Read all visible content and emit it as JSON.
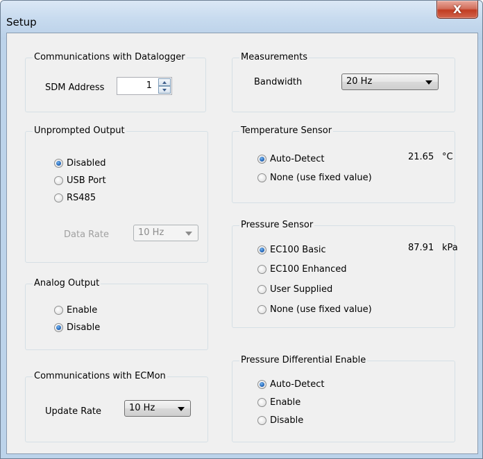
{
  "window": {
    "title": "Setup",
    "close_glyph": "X"
  },
  "comm_datalogger": {
    "title": "Communications with Datalogger",
    "sdm_label": "SDM Address",
    "sdm_value": "1"
  },
  "measurements": {
    "title": "Measurements",
    "bandwidth_label": "Bandwidth",
    "bandwidth_value": "20 Hz"
  },
  "unprompted_output": {
    "title": "Unprompted Output",
    "options": [
      "Disabled",
      "USB Port",
      "RS485"
    ],
    "selected": "Disabled",
    "data_rate_label": "Data Rate",
    "data_rate_value": "10 Hz"
  },
  "temperature_sensor": {
    "title": "Temperature Sensor",
    "options": [
      "Auto-Detect",
      "None (use fixed value)"
    ],
    "selected": "Auto-Detect",
    "reading_value": "21.65",
    "reading_unit": "°C"
  },
  "pressure_sensor": {
    "title": "Pressure Sensor",
    "options": [
      "EC100 Basic",
      "EC100 Enhanced",
      "User Supplied",
      "None (use fixed value)"
    ],
    "selected": "EC100 Basic",
    "reading_value": "87.91",
    "reading_unit": "kPa"
  },
  "analog_output": {
    "title": "Analog Output",
    "options": [
      "Enable",
      "Disable"
    ],
    "selected": "Disable"
  },
  "comm_ecmon": {
    "title": "Communications with ECMon",
    "update_rate_label": "Update Rate",
    "update_rate_value": "10 Hz"
  },
  "pressure_differential": {
    "title": "Pressure Differential Enable",
    "options": [
      "Auto-Detect",
      "Enable",
      "Disable"
    ],
    "selected": "Auto-Detect"
  },
  "colors": {
    "frame": "#bcd3ea",
    "client_bg": "#f0f0f0",
    "group_border": "#d5dfe5",
    "close_button": "#c13c22",
    "disabled_text": "#a0a0a0"
  }
}
